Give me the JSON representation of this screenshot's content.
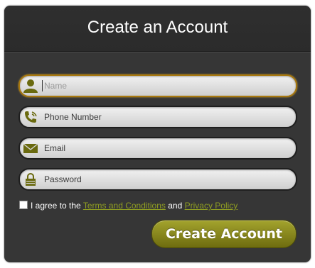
{
  "form": {
    "title": "Create an Account",
    "fields": [
      {
        "placeholder": "Name",
        "icon": "user-icon",
        "focused": true
      },
      {
        "placeholder": "Phone Number",
        "icon": "phone-icon",
        "focused": false
      },
      {
        "placeholder": "Email",
        "icon": "envelope-icon",
        "focused": false
      },
      {
        "placeholder": "Password",
        "icon": "lock-icon",
        "focused": false
      }
    ],
    "terms": {
      "prefix": "I agree to the ",
      "terms_link": "Terms and Conditions",
      "middle": " and ",
      "privacy_link": "Privacy Policy",
      "checked": false
    },
    "submit_label": "Create Account"
  },
  "colors": {
    "card_bg": "#363636",
    "accent_olive": "#7f7d12",
    "focus_border": "#a8780e",
    "link": "#8f9d22",
    "icon": "#6a6a0f"
  }
}
